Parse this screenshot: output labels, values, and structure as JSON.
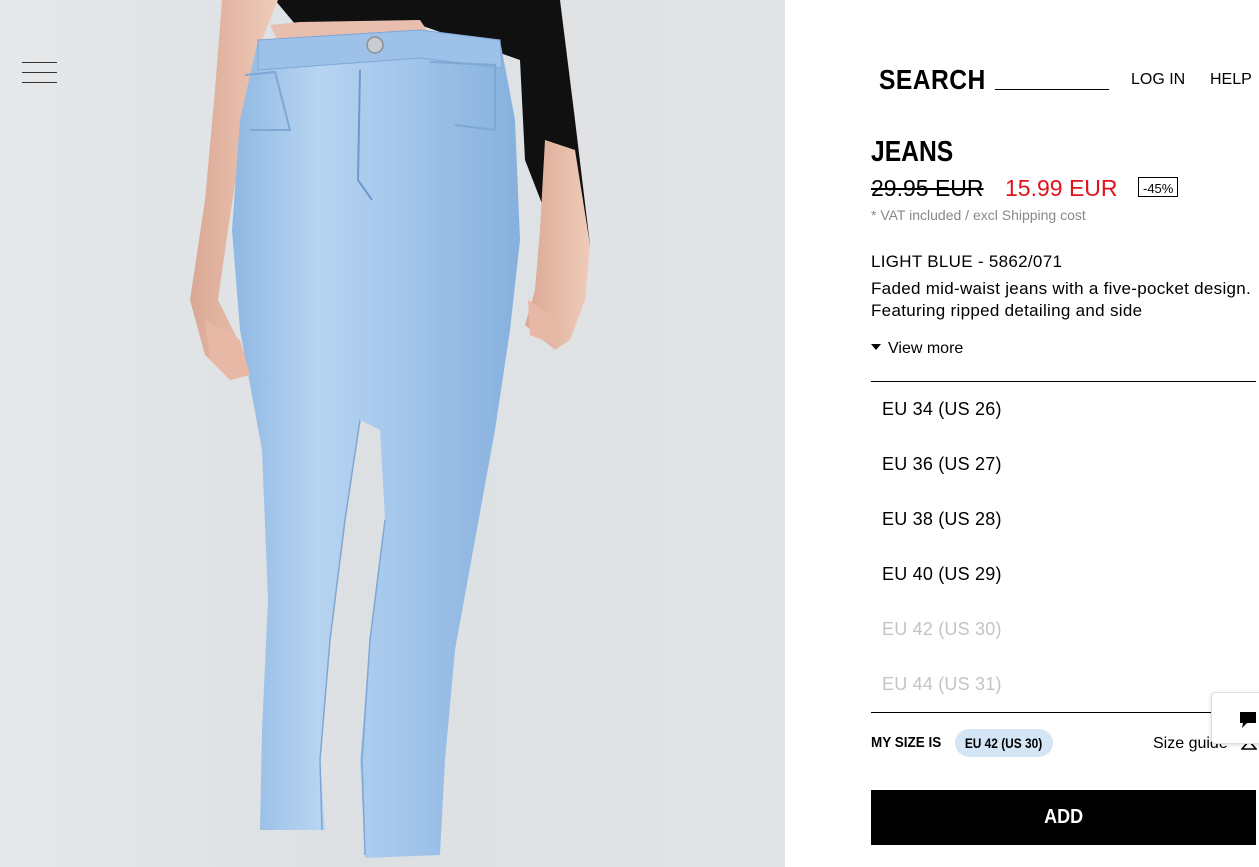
{
  "header": {
    "search_label": "SEARCH",
    "login_label": "LOG IN",
    "help_label": "HELP"
  },
  "product": {
    "title": "JEANS",
    "old_price": "29.95 EUR",
    "new_price": "15.99 EUR",
    "discount": "-45%",
    "vat_note": "* VAT included / excl Shipping cost",
    "color_ref": "LIGHT BLUE - 5862/071",
    "description": "Faded mid-waist jeans with a five-pocket design. Featuring ripped detailing and side",
    "view_more": "View more"
  },
  "sizes": [
    {
      "label": "EU 34 (US 26)",
      "available": true
    },
    {
      "label": "EU 36 (US 27)",
      "available": true
    },
    {
      "label": "EU 38 (US 28)",
      "available": true
    },
    {
      "label": "EU 40 (US 29)",
      "available": true
    },
    {
      "label": "EU 42 (US 30)",
      "available": false
    },
    {
      "label": "EU 44 (US 31)",
      "available": false
    }
  ],
  "my_size": {
    "label": "MY SIZE IS",
    "value": "EU 42 (US 30)"
  },
  "size_guide_label": "Size guide",
  "add_label": "ADD",
  "colors": {
    "sale_price": "#e0131b",
    "my_size_pill": "#d4e6f5",
    "unavailable_size": "#c4c4c4"
  },
  "icons": [
    "menu-icon",
    "hanger-icon",
    "chat-icon"
  ]
}
